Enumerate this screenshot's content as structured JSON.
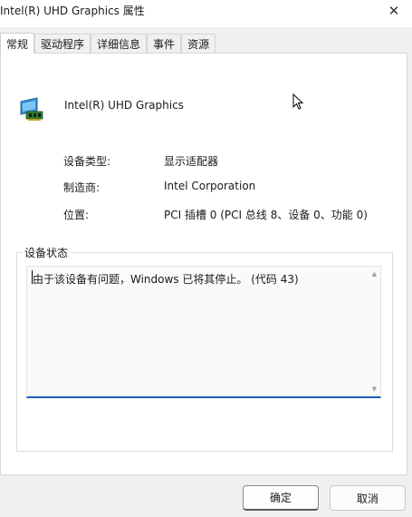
{
  "window": {
    "title": "Intel(R) UHD Graphics 属性",
    "close_glyph": "✕"
  },
  "tabs": [
    "常规",
    "驱动程序",
    "详细信息",
    "事件",
    "资源"
  ],
  "device": {
    "name": "Intel(R) UHD Graphics",
    "icon": "display-adapter-icon"
  },
  "properties": [
    {
      "label": "设备类型:",
      "value": "显示适配器"
    },
    {
      "label": "制造商:",
      "value": "Intel Corporation"
    },
    {
      "label": "位置:",
      "value": "PCI 插槽 0 (PCI 总线 8、设备 0、功能 0)"
    }
  ],
  "status": {
    "group_label": "设备状态",
    "text": "由于该设备有问题，Windows 已将其停止。 (代码 43)"
  },
  "buttons": {
    "ok": "确定",
    "cancel": "取消"
  },
  "colors": {
    "accent": "#1a5fb4",
    "dialog_bg": "#f0f0f0"
  }
}
